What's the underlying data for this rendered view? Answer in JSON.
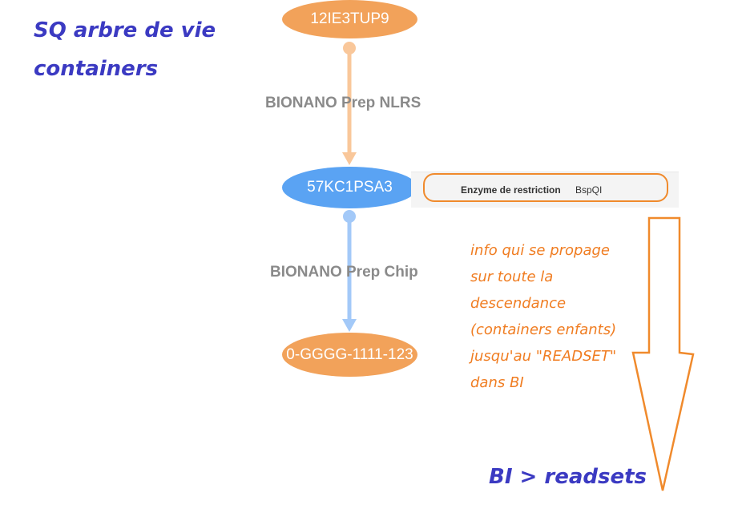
{
  "title": {
    "line1": "SQ arbre de vie",
    "line2": "containers"
  },
  "nodes": {
    "top": {
      "label": "12IE3TUP9",
      "color": "#f2a25a"
    },
    "middle": {
      "label": "57KC1PSA3",
      "color": "#5aa3f3"
    },
    "bottom": {
      "label": "0-GGGG-1111-123",
      "color": "#f2a25a"
    }
  },
  "edges": {
    "first": {
      "label": "BIONANO Prep NLRS",
      "color": "#f9c79a"
    },
    "second": {
      "label": "BIONANO Prep Chip",
      "color": "#a3c9f8"
    }
  },
  "property": {
    "key": "Enzyme de restriction",
    "value": "BspQI"
  },
  "note": {
    "lines": [
      "info qui se propage",
      "sur toute la",
      "descendance",
      "(containers enfants)",
      "jusqu'au \"READSET\"",
      "dans BI"
    ],
    "color": "#f07d22"
  },
  "footer": {
    "label": "BI > readsets",
    "color": "#3b3ac2"
  },
  "icons": {
    "propagation_arrow": "down-arrow-outline-icon"
  }
}
